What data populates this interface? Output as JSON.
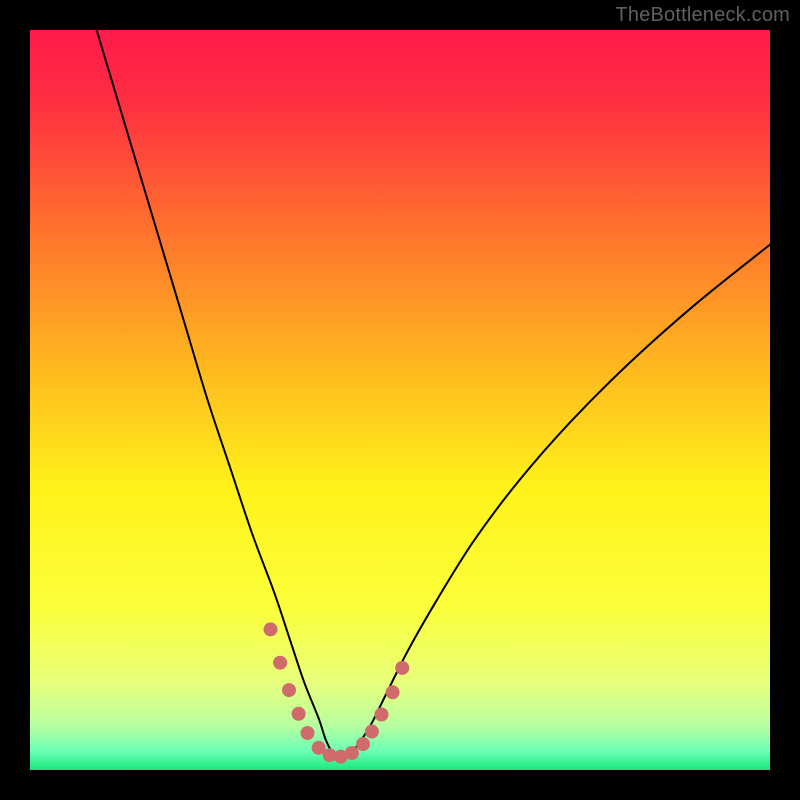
{
  "watermark": "TheBottleneck.com",
  "chart_data": {
    "type": "line",
    "title": "",
    "xlabel": "",
    "ylabel": "",
    "xlim": [
      0,
      100
    ],
    "ylim": [
      0,
      100
    ],
    "gradient_stops": [
      {
        "offset": 0.0,
        "color": "#ff1a4b"
      },
      {
        "offset": 0.1,
        "color": "#ff2f41"
      },
      {
        "offset": 0.25,
        "color": "#ff6a2f"
      },
      {
        "offset": 0.45,
        "color": "#ffb61f"
      },
      {
        "offset": 0.62,
        "color": "#fff21a"
      },
      {
        "offset": 0.78,
        "color": "#fbff3a"
      },
      {
        "offset": 0.88,
        "color": "#e8ff7a"
      },
      {
        "offset": 0.94,
        "color": "#b8ffa0"
      },
      {
        "offset": 0.975,
        "color": "#6affb6"
      },
      {
        "offset": 1.0,
        "color": "#18e87d"
      }
    ],
    "series": [
      {
        "name": "bottleneck-curve",
        "stroke": "#000000",
        "x": [
          9,
          12,
          15,
          18,
          21,
          24,
          27,
          30,
          33,
          35,
          37,
          39,
          40,
          41,
          42,
          43,
          44,
          46,
          48,
          51,
          55,
          60,
          66,
          73,
          81,
          90,
          100
        ],
        "values": [
          100,
          90,
          80,
          70,
          60,
          50,
          41,
          32,
          24,
          18,
          12,
          7,
          4,
          2.2,
          1.8,
          2.0,
          3,
          6,
          10,
          16,
          23,
          31,
          39,
          47,
          55,
          63,
          71
        ]
      }
    ],
    "highlight": {
      "name": "bottleneck-highlight",
      "color": "#cf6b6b",
      "points": [
        {
          "x": 32.5,
          "y": 19.0
        },
        {
          "x": 33.8,
          "y": 14.5
        },
        {
          "x": 35.0,
          "y": 10.8
        },
        {
          "x": 36.3,
          "y": 7.6
        },
        {
          "x": 37.5,
          "y": 5.0
        },
        {
          "x": 39.0,
          "y": 3.0
        },
        {
          "x": 40.5,
          "y": 2.0
        },
        {
          "x": 42.0,
          "y": 1.8
        },
        {
          "x": 43.5,
          "y": 2.3
        },
        {
          "x": 45.0,
          "y": 3.5
        },
        {
          "x": 46.2,
          "y": 5.2
        },
        {
          "x": 47.5,
          "y": 7.5
        },
        {
          "x": 49.0,
          "y": 10.5
        },
        {
          "x": 50.3,
          "y": 13.8
        }
      ]
    }
  }
}
